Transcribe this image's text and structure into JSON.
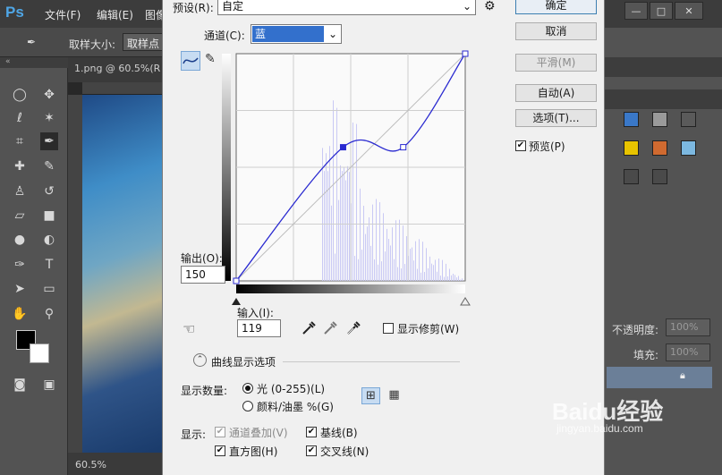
{
  "app": {
    "logo": "Ps",
    "menus": [
      "文件(F)",
      "编辑(E)",
      "图像"
    ],
    "options_bar": {
      "sample_size_label": "取样大小:",
      "sample_size_value": "取样点"
    },
    "document": {
      "tab_title": "1.png @ 60.5%(R",
      "zoom": "60.5%"
    },
    "window_controls": [
      "minimize-icon",
      "maximize-icon",
      "close-icon"
    ]
  },
  "right_panel": {
    "opacity_label": "不透明度:",
    "opacity_value": "100%",
    "fill_label": "填充:",
    "fill_value": "100%"
  },
  "dialog": {
    "preset_label": "预设(R):",
    "preset_value": "自定",
    "channel_label": "通道(C):",
    "channel_value": "蓝",
    "output_label": "输出(O):",
    "output_value": "150",
    "input_label": "输入(I):",
    "input_value": "119",
    "show_clipping_label": "显示修剪(W)",
    "curve_display_options_label": "曲线显示选项",
    "show_amount_label": "显示数量:",
    "amount_options": [
      "光 (0-255)(L)",
      "颜料/油墨 %(G)"
    ],
    "show_label": "显示:",
    "show_options": {
      "channel_overlay": "通道叠加(V)",
      "baseline": "基线(B)",
      "histogram": "直方图(H)",
      "intersection": "交叉线(N)"
    },
    "buttons": {
      "ok": "确定",
      "cancel": "取消",
      "smooth": "平滑(M)",
      "auto": "自动(A)",
      "options": "选项(T)..."
    },
    "preview_label": "预览(P)"
  },
  "curve": {
    "points": [
      [
        0,
        0
      ],
      [
        119,
        150
      ],
      [
        186,
        150
      ],
      [
        255,
        255
      ]
    ],
    "selected_point": [
      119,
      150
    ],
    "color": "#2a2ad0"
  },
  "watermark": {
    "text": "Baidu经验",
    "url": "jingyan.baidu.com"
  }
}
